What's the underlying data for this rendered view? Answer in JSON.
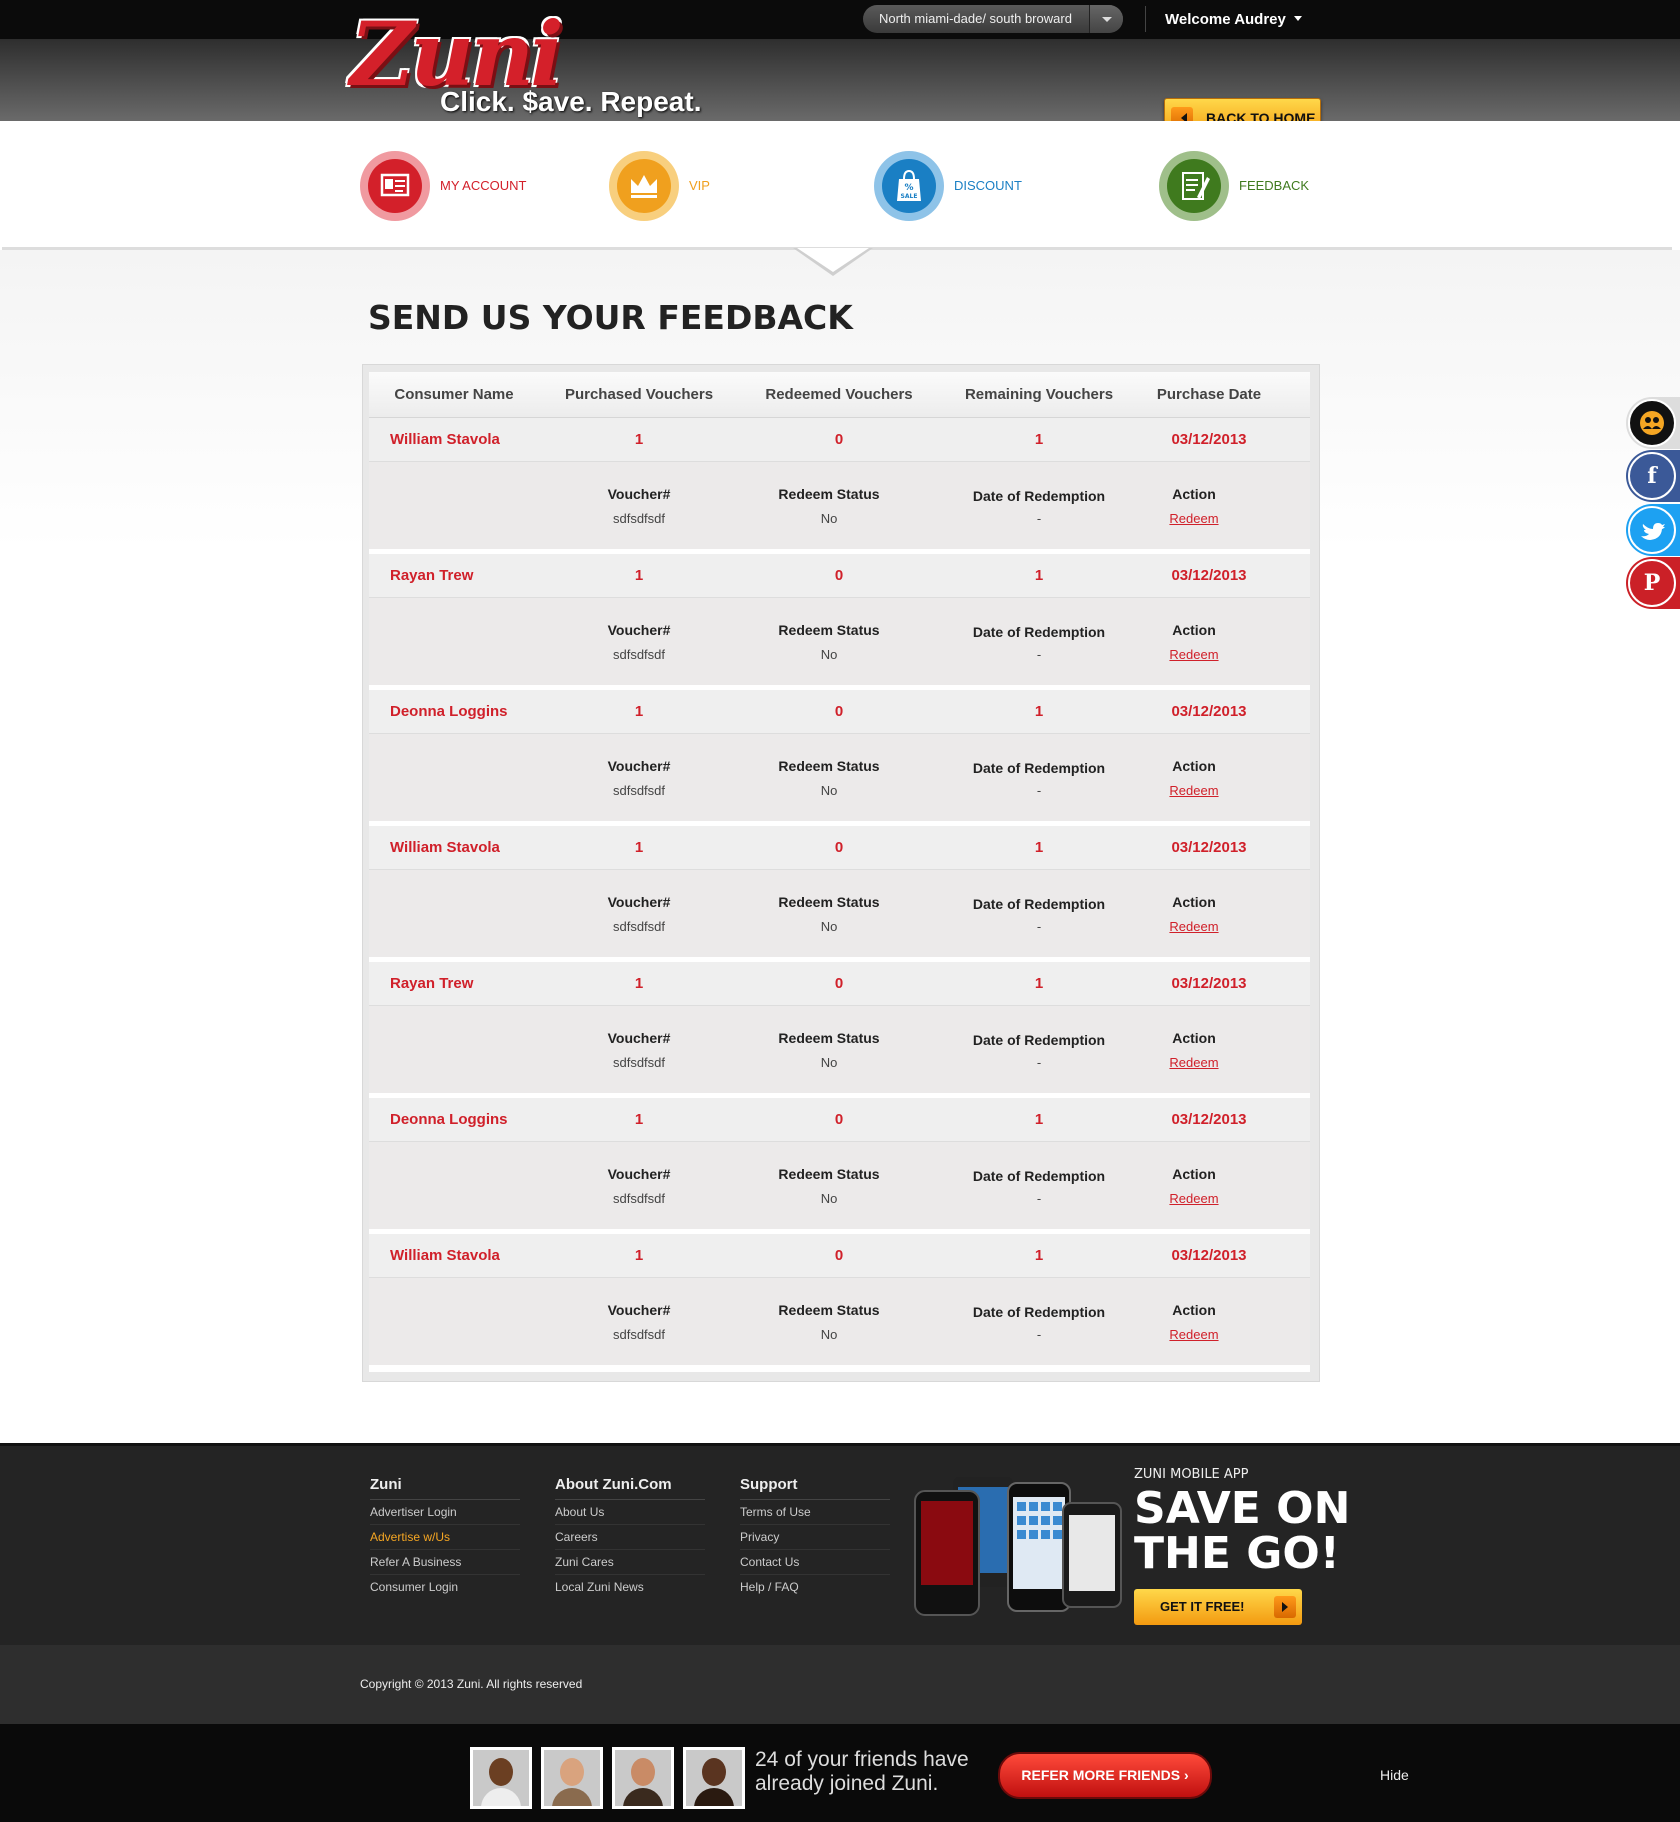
{
  "topbar": {
    "location": "North miami-dade/ south broward",
    "welcome": "Welcome Audrey"
  },
  "logo": {
    "brand": "Zuni",
    "tagline": "Click. $ave. Repeat."
  },
  "header": {
    "back_home": "BACK TO HOME"
  },
  "nav": {
    "items": [
      {
        "label": "MY ACCOUNT",
        "color": "#d3202a"
      },
      {
        "label": "VIP",
        "color": "#f0a01e"
      },
      {
        "label": "DISCOUNT",
        "color": "#1a7fc4"
      },
      {
        "label": "FEEDBACK",
        "color": "#3f7a1e"
      }
    ]
  },
  "page": {
    "title": "SEND US YOUR FEEDBACK"
  },
  "table": {
    "headers": [
      "Consumer Name",
      "Purchased Vouchers",
      "Redeemed Vouchers",
      "Remaining Vouchers",
      "Purchase Date"
    ],
    "sub_headers": {
      "voucher": "Voucher#",
      "status": "Redeem Status",
      "date": "Date of Redemption",
      "action": "Action"
    },
    "rows": [
      {
        "name": "William Stavola",
        "purchased": "1",
        "redeemed": "0",
        "remaining": "1",
        "date": "03/12/2013",
        "voucher": "sdfsdfsdf",
        "status": "No",
        "redeem_date": "-",
        "action": "Redeem"
      },
      {
        "name": "Rayan Trew",
        "purchased": "1",
        "redeemed": "0",
        "remaining": "1",
        "date": "03/12/2013",
        "voucher": "sdfsdfsdf",
        "status": "No",
        "redeem_date": "-",
        "action": "Redeem"
      },
      {
        "name": "Deonna Loggins",
        "purchased": "1",
        "redeemed": "0",
        "remaining": "1",
        "date": "03/12/2013",
        "voucher": "sdfsdfsdf",
        "status": "No",
        "redeem_date": "-",
        "action": "Redeem"
      },
      {
        "name": "William Stavola",
        "purchased": "1",
        "redeemed": "0",
        "remaining": "1",
        "date": "03/12/2013",
        "voucher": "sdfsdfsdf",
        "status": "No",
        "redeem_date": "-",
        "action": "Redeem"
      },
      {
        "name": "Rayan Trew",
        "purchased": "1",
        "redeemed": "0",
        "remaining": "1",
        "date": "03/12/2013",
        "voucher": "sdfsdfsdf",
        "status": "No",
        "redeem_date": "-",
        "action": "Redeem"
      },
      {
        "name": "Deonna Loggins",
        "purchased": "1",
        "redeemed": "0",
        "remaining": "1",
        "date": "03/12/2013",
        "voucher": "sdfsdfsdf",
        "status": "No",
        "redeem_date": "-",
        "action": "Redeem"
      },
      {
        "name": "William Stavola",
        "purchased": "1",
        "redeemed": "0",
        "remaining": "1",
        "date": "03/12/2013",
        "voucher": "sdfsdfsdf",
        "status": "No",
        "redeem_date": "-",
        "action": "Redeem"
      }
    ]
  },
  "social": [
    {
      "icon": "friends-icon",
      "color": "#111111"
    },
    {
      "icon": "facebook-icon",
      "color": "#3b5998"
    },
    {
      "icon": "twitter-icon",
      "color": "#1da1f2"
    },
    {
      "icon": "pinterest-icon",
      "color": "#cb2027"
    }
  ],
  "footer": {
    "columns": [
      {
        "heading": "Zuni",
        "items": [
          "Advertiser Login",
          "Advertise w/Us",
          "Refer A Business",
          "Consumer Login"
        ]
      },
      {
        "heading": "About Zuni.Com",
        "items": [
          "About Us",
          "Careers",
          "Zuni Cares",
          "Local Zuni News"
        ]
      },
      {
        "heading": "Support",
        "items": [
          "Terms of Use",
          "Privacy",
          "Contact Us",
          "Help / FAQ"
        ]
      }
    ],
    "highlight_color": "#f5a623",
    "app_label": "ZUNI MOBILE APP",
    "app_headline": "SAVE ON THE GO!",
    "get_it": "GET IT FREE!",
    "copyright": "Copyright © 2013 Zuni. All rights reserved"
  },
  "refer": {
    "text": "24 of your friends have already joined Zuni.",
    "button": "REFER MORE FRIENDS",
    "hide": "Hide"
  }
}
